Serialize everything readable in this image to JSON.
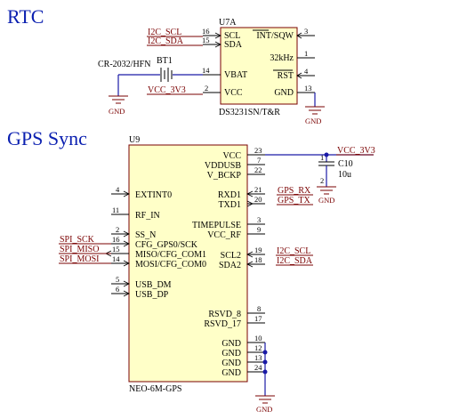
{
  "rtc": {
    "title": "RTC",
    "ref": "U7A",
    "part": "DS3231SN/T&R",
    "left_pins": [
      {
        "name": "SCL",
        "num": "16"
      },
      {
        "name": "SDA",
        "num": "15"
      },
      {
        "name": "VBAT",
        "num": "14"
      },
      {
        "name": "VCC",
        "num": "2"
      }
    ],
    "right_pins": [
      {
        "name": "INT/SQW",
        "num": "3"
      },
      {
        "name": "32kHz",
        "num": "1"
      },
      {
        "name": "RST",
        "num": "4"
      },
      {
        "name": "GND",
        "num": "13"
      }
    ],
    "nets": {
      "scl": "I2C_SCL",
      "sda": "I2C_SDA",
      "vcc": "VCC_3V3"
    },
    "battery": {
      "ref": "BT1",
      "part": "CR-2032/HFN"
    },
    "gnd_label": "GND"
  },
  "gps": {
    "title": "GPS Sync",
    "ref": "U9",
    "part": "NEO-6M-GPS",
    "left_pins": [
      {
        "name": "EXTINT0",
        "num": "4"
      },
      {
        "name": "RF_IN",
        "num": "11"
      },
      {
        "name": "SS_N",
        "num": "2"
      },
      {
        "name": "CFG_GPS0/SCK",
        "num": "16"
      },
      {
        "name": "MISO/CFG_COM1",
        "num": "15"
      },
      {
        "name": "MOSI/CFG_COM0",
        "num": "14"
      },
      {
        "name": "USB_DM",
        "num": "5"
      },
      {
        "name": "USB_DP",
        "num": "6"
      }
    ],
    "right_pins": [
      {
        "name": "VCC",
        "num": "23"
      },
      {
        "name": "VDDUSB",
        "num": "7"
      },
      {
        "name": "V_BCKP",
        "num": "22"
      },
      {
        "name": "RXD1",
        "num": "21"
      },
      {
        "name": "TXD1",
        "num": "20"
      },
      {
        "name": "TIMEPULSE",
        "num": "3"
      },
      {
        "name": "VCC_RF",
        "num": "9"
      },
      {
        "name": "SCL2",
        "num": "19"
      },
      {
        "name": "SDA2",
        "num": "18"
      },
      {
        "name": "RSVD_8",
        "num": "8"
      },
      {
        "name": "RSVD_17",
        "num": "17"
      },
      {
        "name": "GND",
        "num": "10"
      },
      {
        "name": "GND",
        "num": "12"
      },
      {
        "name": "GND",
        "num": "13"
      },
      {
        "name": "GND",
        "num": "24"
      }
    ],
    "nets": {
      "spi_sck": "SPI_SCK",
      "spi_miso": "SPI_MISO",
      "spi_mosi": "SPI_MOSI",
      "gps_rx": "GPS_RX",
      "gps_tx": "GPS_TX",
      "scl": "I2C_SCL",
      "sda": "I2C_SDA",
      "vcc": "VCC_3V3"
    },
    "cap": {
      "ref": "C10",
      "value": "10u",
      "pin1": "1",
      "pin2": "2"
    },
    "gnd_label": "GND"
  }
}
